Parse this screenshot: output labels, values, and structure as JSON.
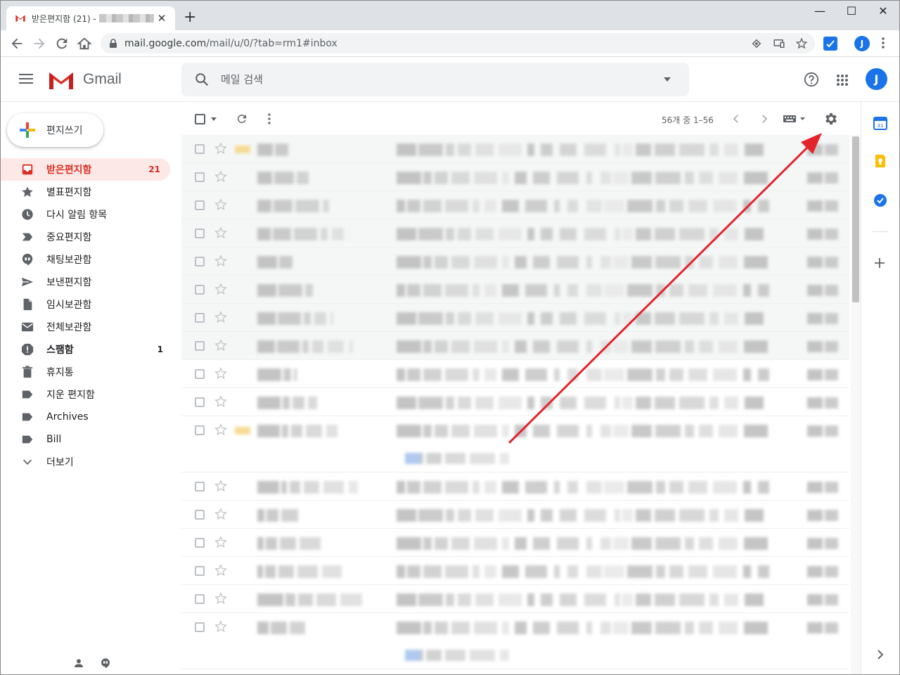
{
  "browser": {
    "tab_title": "받은편지함 (21) -",
    "tab_close": "✕",
    "new_tab": "+",
    "window_controls": {
      "minimize": "—",
      "maximize": "☐",
      "close": "✕"
    },
    "url_host": "mail.google.com",
    "url_path": "/mail/u/0/?tab=rm1#inbox",
    "profile_initial": "J"
  },
  "gmail": {
    "brand": "Gmail",
    "search_placeholder": "메일 검색",
    "avatar_initial": "J",
    "compose_label": "편지쓰기",
    "nav": [
      {
        "label": "받은편지함",
        "count": "21",
        "icon": "inbox-icon",
        "active": true
      },
      {
        "label": "별표편지함",
        "count": "",
        "icon": "star-icon"
      },
      {
        "label": "다시 알림 항목",
        "count": "",
        "icon": "clock-icon"
      },
      {
        "label": "중요편지함",
        "count": "",
        "icon": "important-icon"
      },
      {
        "label": "채팅보관함",
        "count": "",
        "icon": "chat-icon"
      },
      {
        "label": "보낸편지함",
        "count": "",
        "icon": "send-icon"
      },
      {
        "label": "임시보관함",
        "count": "",
        "icon": "draft-icon"
      },
      {
        "label": "전체보관함",
        "count": "",
        "icon": "mail-icon"
      },
      {
        "label": "스팸함",
        "count": "1",
        "icon": "spam-icon",
        "bold": true
      },
      {
        "label": "휴지통",
        "count": "",
        "icon": "trash-icon"
      },
      {
        "label": "지운 편지함",
        "count": "",
        "icon": "label-icon"
      },
      {
        "label": "Archives",
        "count": "",
        "icon": "label-icon"
      },
      {
        "label": "Bill",
        "count": "",
        "icon": "label-icon"
      },
      {
        "label": "더보기",
        "count": "",
        "icon": "chevron-down-icon"
      }
    ],
    "pagination": "56개 중 1–56",
    "rows": [
      {
        "read": true,
        "important": true,
        "tall": false
      },
      {
        "read": true,
        "important": false,
        "tall": false
      },
      {
        "read": true,
        "important": false,
        "tall": false
      },
      {
        "read": true,
        "important": false,
        "tall": false
      },
      {
        "read": true,
        "important": false,
        "tall": false
      },
      {
        "read": true,
        "important": false,
        "tall": false
      },
      {
        "read": true,
        "important": false,
        "tall": false
      },
      {
        "read": true,
        "important": false,
        "tall": false
      },
      {
        "read": false,
        "important": false,
        "tall": false
      },
      {
        "read": false,
        "important": false,
        "tall": false
      },
      {
        "read": false,
        "important": true,
        "tall": true
      },
      {
        "read": false,
        "important": false,
        "tall": false
      },
      {
        "read": false,
        "important": false,
        "tall": false
      },
      {
        "read": false,
        "important": false,
        "tall": false
      },
      {
        "read": false,
        "important": false,
        "tall": false
      },
      {
        "read": false,
        "important": false,
        "tall": false
      },
      {
        "read": false,
        "important": false,
        "tall": true
      }
    ]
  },
  "colors": {
    "accent_red": "#d93025",
    "annotation_arrow": "#e3242b",
    "google_blue": "#1a73e8"
  }
}
